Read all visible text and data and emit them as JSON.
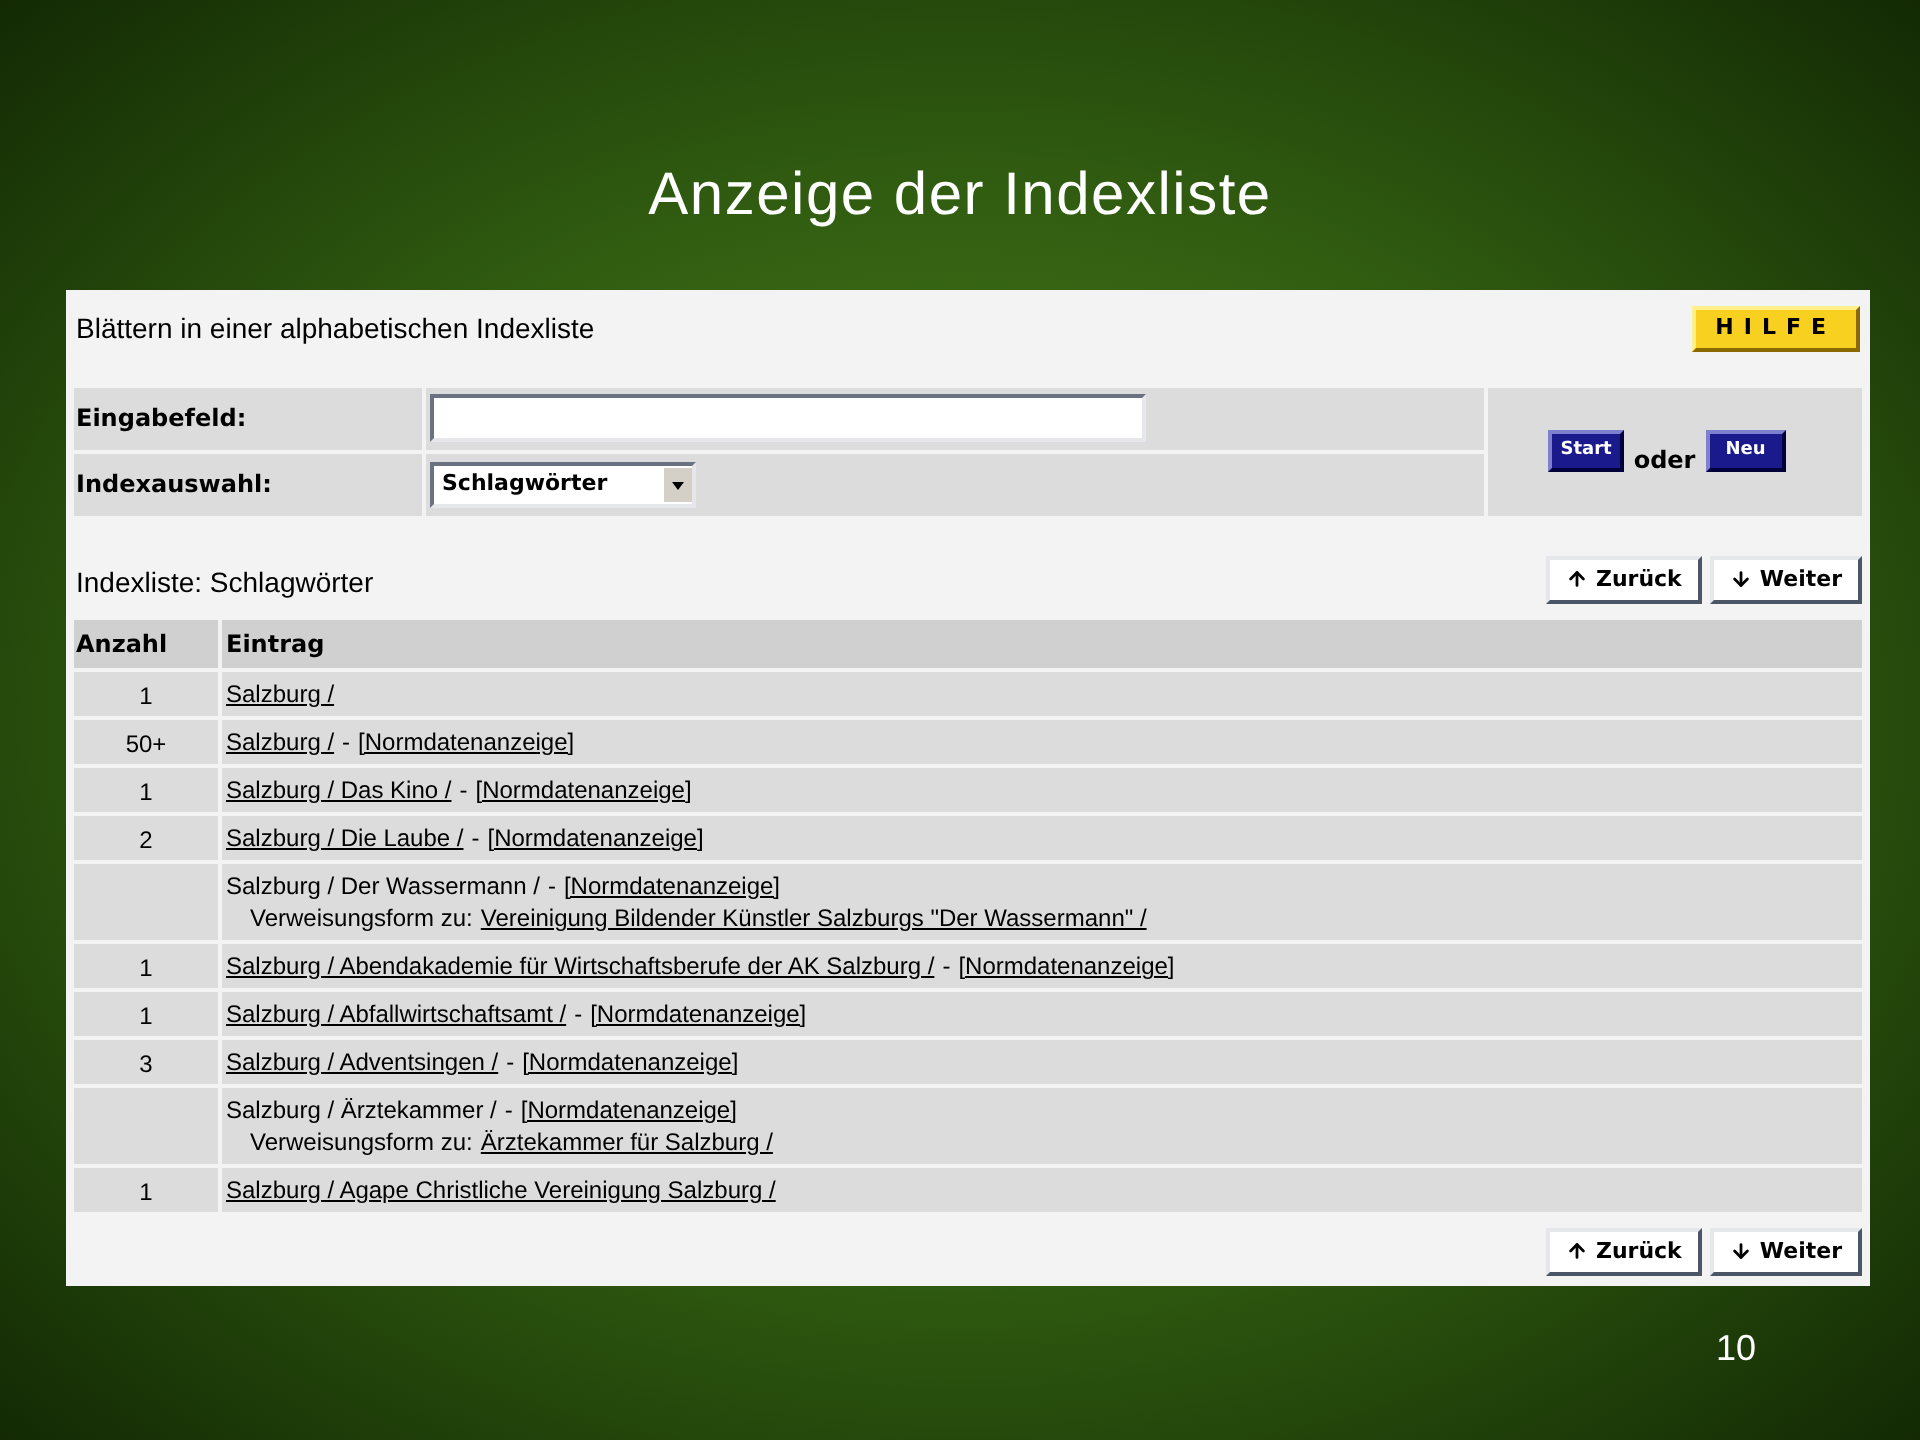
{
  "slide": {
    "title": "Anzeige der Indexliste",
    "page_number": "10"
  },
  "page": {
    "heading": "Blättern in einer alphabetischen Indexliste",
    "help_button": "HILFE"
  },
  "form": {
    "input_label": "Eingabefeld:",
    "index_label": "Indexauswahl:",
    "index_value": "Schlagwörter",
    "start_button": "Start",
    "or_text": "oder",
    "new_button": "Neu"
  },
  "list": {
    "title": "Indexliste: Schlagwörter",
    "back_button": "Zurück",
    "next_button": "Weiter",
    "columns": [
      "Anzahl",
      "Eintrag"
    ],
    "rows": [
      {
        "count": "1",
        "entry": "Salzburg /",
        "entry_linked": true
      },
      {
        "count": "50+",
        "entry": "Salzburg /",
        "entry_linked": true,
        "norm": {
          "separator": "-",
          "link": "[Normdatenanzeige]"
        }
      },
      {
        "count": "1",
        "entry": "Salzburg / Das Kino /",
        "entry_linked": true,
        "norm": {
          "separator": "-",
          "link": "[Normdatenanzeige]"
        }
      },
      {
        "count": "2",
        "entry": "Salzburg / Die Laube /",
        "entry_linked": true,
        "norm": {
          "separator": "-",
          "link": "[Normdatenanzeige]"
        }
      },
      {
        "entry": "Salzburg / Der Wassermann /",
        "entry_linked": false,
        "norm": {
          "separator": "-",
          "link": "[Normdatenanzeige]"
        },
        "reference_label": "Verweisungsform zu:",
        "reference_link": "Vereinigung Bildender Künstler Salzburgs \"Der Wassermann\" /"
      },
      {
        "count": "1",
        "entry": "Salzburg / Abendakademie für Wirtschaftsberufe der AK Salzburg /",
        "entry_linked": true,
        "norm": {
          "separator": "-",
          "link": "[Normdatenanzeige]"
        }
      },
      {
        "count": "1",
        "entry": "Salzburg / Abfallwirtschaftsamt /",
        "entry_linked": true,
        "norm": {
          "separator": "-",
          "link": "[Normdatenanzeige]"
        }
      },
      {
        "count": "3",
        "entry": "Salzburg / Adventsingen /",
        "entry_linked": true,
        "norm": {
          "separator": "-",
          "link": "[Normdatenanzeige]"
        }
      },
      {
        "entry": "Salzburg / Ärztekammer /",
        "entry_linked": false,
        "norm": {
          "separator": "-",
          "link": "[Normdatenanzeige]"
        },
        "reference_label": "Verweisungsform zu:",
        "reference_link": "Ärztekammer für Salzburg /"
      },
      {
        "count": "1",
        "entry": "Salzburg / Agape Christliche Vereinigung Salzburg /",
        "entry_linked": true
      }
    ]
  },
  "bottom_nav": {
    "back_button": "Zurück",
    "next_button": "Weiter"
  }
}
